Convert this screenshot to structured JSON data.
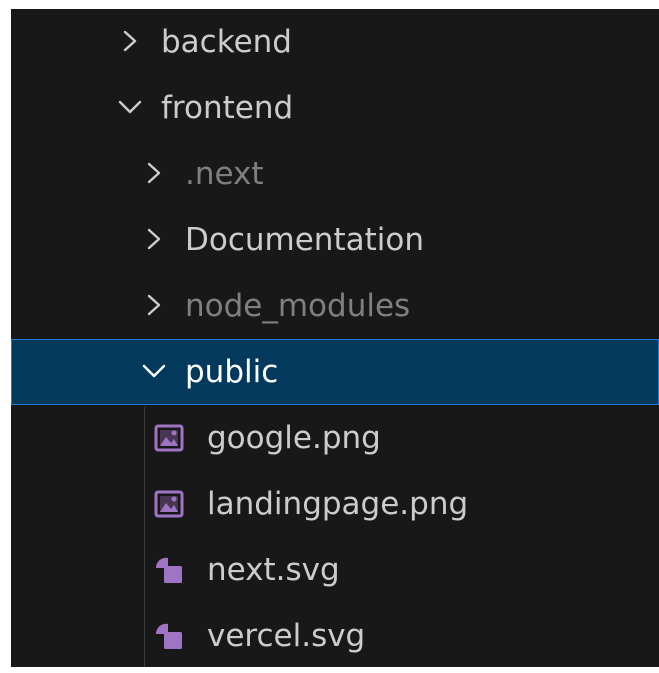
{
  "explorer": {
    "items": [
      {
        "label": "backend",
        "expanded": false,
        "kind": "folder"
      },
      {
        "label": "frontend",
        "expanded": true,
        "kind": "folder"
      },
      {
        "label": ".next",
        "expanded": false,
        "kind": "folder",
        "dimmed": true
      },
      {
        "label": "Documentation",
        "expanded": false,
        "kind": "folder"
      },
      {
        "label": "node_modules",
        "expanded": false,
        "kind": "folder",
        "dimmed": true
      },
      {
        "label": "public",
        "expanded": true,
        "kind": "folder",
        "selected": true
      },
      {
        "label": "google.png",
        "kind": "file",
        "icon": "image-icon"
      },
      {
        "label": "landingpage.png",
        "kind": "file",
        "icon": "image-icon"
      },
      {
        "label": "next.svg",
        "kind": "file",
        "icon": "svg-shapes-icon"
      },
      {
        "label": "vercel.svg",
        "kind": "file",
        "icon": "svg-shapes-icon"
      }
    ]
  },
  "colors": {
    "background": "#181818",
    "selection": "#04395e",
    "selection_border": "#1f7ad1",
    "text": "#cccccc",
    "text_dimmed": "#7f7f7f",
    "file_icon_purple": "#a074c4"
  }
}
